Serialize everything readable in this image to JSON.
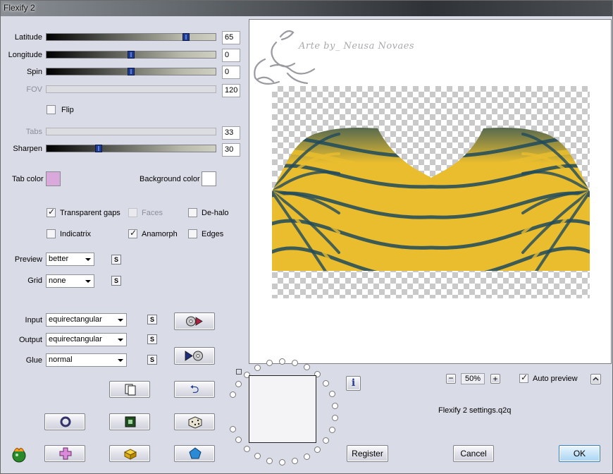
{
  "window": {
    "title": "Flexify 2"
  },
  "sliders": {
    "latitude": {
      "label": "Latitude",
      "value": "65",
      "position": 0.84
    },
    "longitude": {
      "label": "Longitude",
      "value": "0",
      "position": 0.5
    },
    "spin": {
      "label": "Spin",
      "value": "0",
      "position": 0.5
    },
    "fov": {
      "label": "FOV",
      "value": "120"
    },
    "tabs": {
      "label": "Tabs",
      "value": "33"
    },
    "sharpen": {
      "label": "Sharpen",
      "value": "30",
      "position": 0.3
    }
  },
  "flip": {
    "label": "Flip",
    "checked": false
  },
  "colors": {
    "tab_color": {
      "label": "Tab color",
      "value": "#d9a9dc"
    },
    "background_color": {
      "label": "Background color",
      "value": "#ffffff"
    }
  },
  "options": {
    "transparent_gaps": {
      "label": "Transparent gaps",
      "checked": true
    },
    "faces": {
      "label": "Faces",
      "checked": false
    },
    "de_halo": {
      "label": "De-halo",
      "checked": false
    },
    "indicatrix": {
      "label": "Indicatrix",
      "checked": false
    },
    "anamorph": {
      "label": "Anamorph",
      "checked": true
    },
    "edges": {
      "label": "Edges",
      "checked": false
    }
  },
  "preview_select": {
    "label": "Preview",
    "value": "better"
  },
  "grid_select": {
    "label": "Grid",
    "value": "none"
  },
  "input_select": {
    "label": "Input",
    "value": "equirectangular"
  },
  "output_select": {
    "label": "Output",
    "value": "equirectangular"
  },
  "glue_select": {
    "label": "Glue",
    "value": "normal"
  },
  "small_button_label": "S",
  "preview": {
    "watermark": "Arte by_ Neusa Novaes",
    "colors": {
      "gold": "#e9bd2e",
      "teal": "#1f4a5c"
    }
  },
  "zoom": {
    "minus": "−",
    "value": "50%",
    "plus": "+"
  },
  "auto_preview": {
    "label": "Auto preview",
    "checked": true
  },
  "settings_file": "Flexify 2 settings.q2q",
  "buttons": {
    "register": "Register",
    "cancel": "Cancel",
    "ok": "OK"
  },
  "icons": {
    "info": "i",
    "undo": "⮌"
  }
}
